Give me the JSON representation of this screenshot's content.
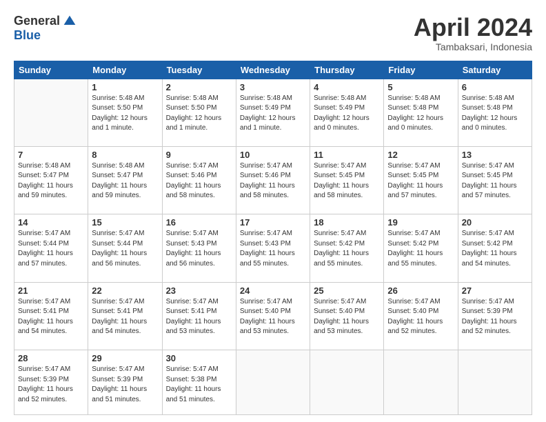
{
  "header": {
    "logo_general": "General",
    "logo_blue": "Blue",
    "title": "April 2024",
    "location": "Tambaksari, Indonesia"
  },
  "days_of_week": [
    "Sunday",
    "Monday",
    "Tuesday",
    "Wednesday",
    "Thursday",
    "Friday",
    "Saturday"
  ],
  "weeks": [
    [
      {
        "num": "",
        "sunrise": "",
        "sunset": "",
        "daylight": "",
        "empty": true
      },
      {
        "num": "1",
        "sunrise": "Sunrise: 5:48 AM",
        "sunset": "Sunset: 5:50 PM",
        "daylight": "Daylight: 12 hours and 1 minute."
      },
      {
        "num": "2",
        "sunrise": "Sunrise: 5:48 AM",
        "sunset": "Sunset: 5:50 PM",
        "daylight": "Daylight: 12 hours and 1 minute."
      },
      {
        "num": "3",
        "sunrise": "Sunrise: 5:48 AM",
        "sunset": "Sunset: 5:49 PM",
        "daylight": "Daylight: 12 hours and 1 minute."
      },
      {
        "num": "4",
        "sunrise": "Sunrise: 5:48 AM",
        "sunset": "Sunset: 5:49 PM",
        "daylight": "Daylight: 12 hours and 0 minutes."
      },
      {
        "num": "5",
        "sunrise": "Sunrise: 5:48 AM",
        "sunset": "Sunset: 5:48 PM",
        "daylight": "Daylight: 12 hours and 0 minutes."
      },
      {
        "num": "6",
        "sunrise": "Sunrise: 5:48 AM",
        "sunset": "Sunset: 5:48 PM",
        "daylight": "Daylight: 12 hours and 0 minutes."
      }
    ],
    [
      {
        "num": "7",
        "sunrise": "Sunrise: 5:48 AM",
        "sunset": "Sunset: 5:47 PM",
        "daylight": "Daylight: 11 hours and 59 minutes."
      },
      {
        "num": "8",
        "sunrise": "Sunrise: 5:48 AM",
        "sunset": "Sunset: 5:47 PM",
        "daylight": "Daylight: 11 hours and 59 minutes."
      },
      {
        "num": "9",
        "sunrise": "Sunrise: 5:47 AM",
        "sunset": "Sunset: 5:46 PM",
        "daylight": "Daylight: 11 hours and 58 minutes."
      },
      {
        "num": "10",
        "sunrise": "Sunrise: 5:47 AM",
        "sunset": "Sunset: 5:46 PM",
        "daylight": "Daylight: 11 hours and 58 minutes."
      },
      {
        "num": "11",
        "sunrise": "Sunrise: 5:47 AM",
        "sunset": "Sunset: 5:45 PM",
        "daylight": "Daylight: 11 hours and 58 minutes."
      },
      {
        "num": "12",
        "sunrise": "Sunrise: 5:47 AM",
        "sunset": "Sunset: 5:45 PM",
        "daylight": "Daylight: 11 hours and 57 minutes."
      },
      {
        "num": "13",
        "sunrise": "Sunrise: 5:47 AM",
        "sunset": "Sunset: 5:45 PM",
        "daylight": "Daylight: 11 hours and 57 minutes."
      }
    ],
    [
      {
        "num": "14",
        "sunrise": "Sunrise: 5:47 AM",
        "sunset": "Sunset: 5:44 PM",
        "daylight": "Daylight: 11 hours and 57 minutes."
      },
      {
        "num": "15",
        "sunrise": "Sunrise: 5:47 AM",
        "sunset": "Sunset: 5:44 PM",
        "daylight": "Daylight: 11 hours and 56 minutes."
      },
      {
        "num": "16",
        "sunrise": "Sunrise: 5:47 AM",
        "sunset": "Sunset: 5:43 PM",
        "daylight": "Daylight: 11 hours and 56 minutes."
      },
      {
        "num": "17",
        "sunrise": "Sunrise: 5:47 AM",
        "sunset": "Sunset: 5:43 PM",
        "daylight": "Daylight: 11 hours and 55 minutes."
      },
      {
        "num": "18",
        "sunrise": "Sunrise: 5:47 AM",
        "sunset": "Sunset: 5:42 PM",
        "daylight": "Daylight: 11 hours and 55 minutes."
      },
      {
        "num": "19",
        "sunrise": "Sunrise: 5:47 AM",
        "sunset": "Sunset: 5:42 PM",
        "daylight": "Daylight: 11 hours and 55 minutes."
      },
      {
        "num": "20",
        "sunrise": "Sunrise: 5:47 AM",
        "sunset": "Sunset: 5:42 PM",
        "daylight": "Daylight: 11 hours and 54 minutes."
      }
    ],
    [
      {
        "num": "21",
        "sunrise": "Sunrise: 5:47 AM",
        "sunset": "Sunset: 5:41 PM",
        "daylight": "Daylight: 11 hours and 54 minutes."
      },
      {
        "num": "22",
        "sunrise": "Sunrise: 5:47 AM",
        "sunset": "Sunset: 5:41 PM",
        "daylight": "Daylight: 11 hours and 54 minutes."
      },
      {
        "num": "23",
        "sunrise": "Sunrise: 5:47 AM",
        "sunset": "Sunset: 5:41 PM",
        "daylight": "Daylight: 11 hours and 53 minutes."
      },
      {
        "num": "24",
        "sunrise": "Sunrise: 5:47 AM",
        "sunset": "Sunset: 5:40 PM",
        "daylight": "Daylight: 11 hours and 53 minutes."
      },
      {
        "num": "25",
        "sunrise": "Sunrise: 5:47 AM",
        "sunset": "Sunset: 5:40 PM",
        "daylight": "Daylight: 11 hours and 53 minutes."
      },
      {
        "num": "26",
        "sunrise": "Sunrise: 5:47 AM",
        "sunset": "Sunset: 5:40 PM",
        "daylight": "Daylight: 11 hours and 52 minutes."
      },
      {
        "num": "27",
        "sunrise": "Sunrise: 5:47 AM",
        "sunset": "Sunset: 5:39 PM",
        "daylight": "Daylight: 11 hours and 52 minutes."
      }
    ],
    [
      {
        "num": "28",
        "sunrise": "Sunrise: 5:47 AM",
        "sunset": "Sunset: 5:39 PM",
        "daylight": "Daylight: 11 hours and 52 minutes."
      },
      {
        "num": "29",
        "sunrise": "Sunrise: 5:47 AM",
        "sunset": "Sunset: 5:39 PM",
        "daylight": "Daylight: 11 hours and 51 minutes."
      },
      {
        "num": "30",
        "sunrise": "Sunrise: 5:47 AM",
        "sunset": "Sunset: 5:38 PM",
        "daylight": "Daylight: 11 hours and 51 minutes."
      },
      {
        "num": "",
        "sunrise": "",
        "sunset": "",
        "daylight": "",
        "empty": true
      },
      {
        "num": "",
        "sunrise": "",
        "sunset": "",
        "daylight": "",
        "empty": true
      },
      {
        "num": "",
        "sunrise": "",
        "sunset": "",
        "daylight": "",
        "empty": true
      },
      {
        "num": "",
        "sunrise": "",
        "sunset": "",
        "daylight": "",
        "empty": true
      }
    ]
  ]
}
